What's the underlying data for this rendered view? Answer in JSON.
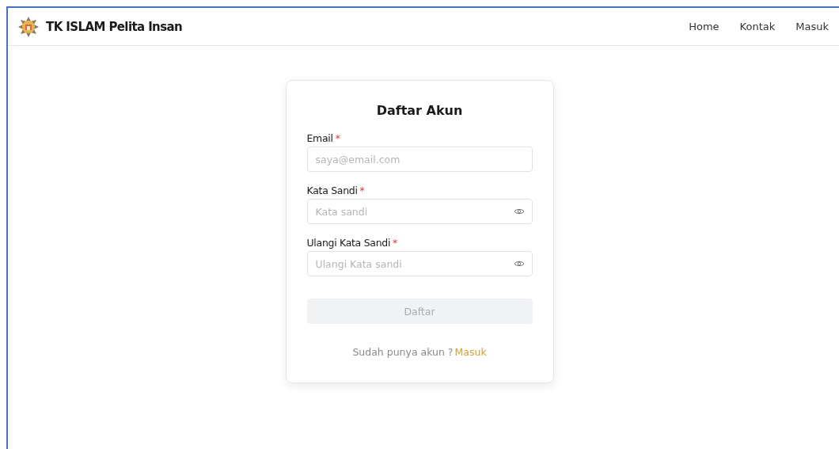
{
  "brand": {
    "name": "TK ISLAM Pelita Insan"
  },
  "nav": [
    {
      "label": "Home"
    },
    {
      "label": "Kontak"
    },
    {
      "label": "Masuk"
    }
  ],
  "form": {
    "title": "Daftar Akun",
    "fields": [
      {
        "label": "Email",
        "required": true,
        "required_mark": "*",
        "placeholder": "saya@email.com",
        "kind": "text"
      },
      {
        "label": "Kata Sandi",
        "required": true,
        "required_mark": "*",
        "placeholder": "Kata sandi",
        "kind": "password"
      },
      {
        "label": "Ulangi Kata Sandi",
        "required": true,
        "required_mark": "*",
        "placeholder": "Ulangi Kata sandi",
        "kind": "password"
      }
    ],
    "submit": {
      "label": "Daftar",
      "disabled": true
    },
    "footer": {
      "text": "Sudah punya akun ?",
      "link": "Masuk"
    }
  }
}
